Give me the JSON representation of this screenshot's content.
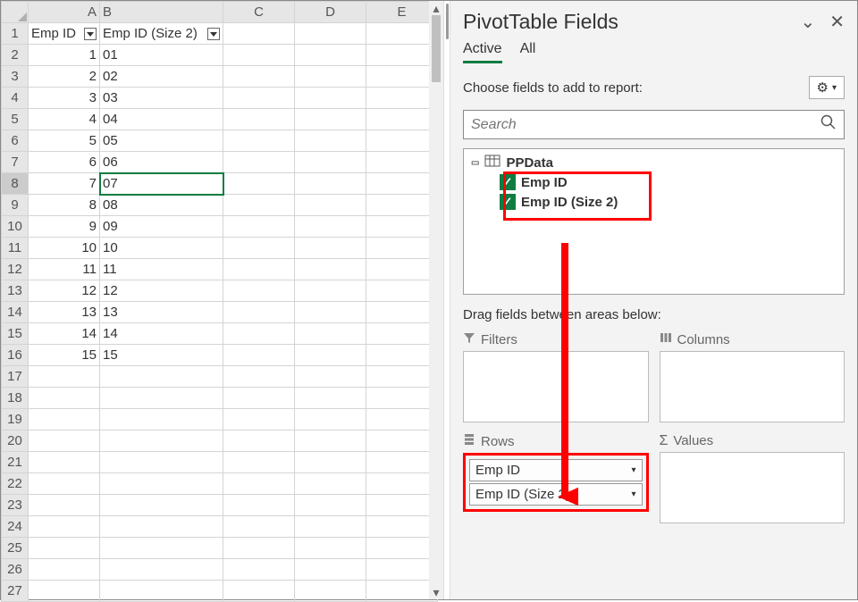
{
  "columns": [
    "A",
    "B",
    "C",
    "D",
    "E"
  ],
  "headers": {
    "colA": "Emp ID",
    "colB": "Emp ID (Size 2)"
  },
  "rows": [
    {
      "n": 1,
      "a": "",
      "b_is_header": true
    },
    {
      "n": 2,
      "a": "1",
      "b": "01"
    },
    {
      "n": 3,
      "a": "2",
      "b": "02"
    },
    {
      "n": 4,
      "a": "3",
      "b": "03"
    },
    {
      "n": 5,
      "a": "4",
      "b": "04"
    },
    {
      "n": 6,
      "a": "5",
      "b": "05"
    },
    {
      "n": 7,
      "a": "6",
      "b": "06"
    },
    {
      "n": 8,
      "a": "7",
      "b": "07",
      "selected": true
    },
    {
      "n": 9,
      "a": "8",
      "b": "08"
    },
    {
      "n": 10,
      "a": "9",
      "b": "09"
    },
    {
      "n": 11,
      "a": "10",
      "b": "10"
    },
    {
      "n": 12,
      "a": "11",
      "b": "11"
    },
    {
      "n": 13,
      "a": "12",
      "b": "12"
    },
    {
      "n": 14,
      "a": "13",
      "b": "13"
    },
    {
      "n": 15,
      "a": "14",
      "b": "14"
    },
    {
      "n": 16,
      "a": "15",
      "b": "15"
    },
    {
      "n": 17,
      "a": "",
      "b": ""
    },
    {
      "n": 18,
      "a": "",
      "b": ""
    },
    {
      "n": 19,
      "a": "",
      "b": ""
    },
    {
      "n": 20,
      "a": "",
      "b": ""
    },
    {
      "n": 21,
      "a": "",
      "b": ""
    },
    {
      "n": 22,
      "a": "",
      "b": ""
    },
    {
      "n": 23,
      "a": "",
      "b": ""
    },
    {
      "n": 24,
      "a": "",
      "b": ""
    },
    {
      "n": 25,
      "a": "",
      "b": ""
    },
    {
      "n": 26,
      "a": "",
      "b": ""
    },
    {
      "n": 27,
      "a": "",
      "b": ""
    }
  ],
  "panel": {
    "title": "PivotTable Fields",
    "tabs": [
      "Active",
      "All"
    ],
    "choose_text": "Choose fields to add to report:",
    "search_placeholder": "Search",
    "table_name": "PPData",
    "fields": [
      "Emp ID",
      "Emp ID (Size 2)"
    ],
    "drag_text": "Drag fields between areas below:",
    "zones": {
      "filters": "Filters",
      "columns": "Columns",
      "rows": "Rows",
      "values": "Values"
    },
    "row_items": [
      "Emp ID",
      "Emp ID (Size 2)"
    ]
  }
}
